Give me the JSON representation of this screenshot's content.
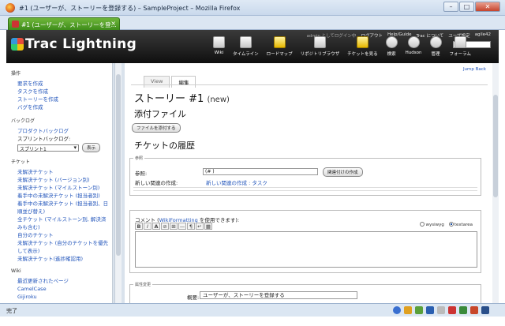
{
  "window": {
    "title": "#1 (ユーザーが、ストーリーを登録する) – SampleProject – Mozilla Firefox",
    "minimize": "–",
    "maximize": "□",
    "close": "✕"
  },
  "tab": {
    "label": "#1 (ユーザーが、ストーリーを登...",
    "close": "×"
  },
  "header": {
    "logo": "Trac Lightning",
    "metanav": [
      "admin としてログイン中",
      "ログアウト",
      "Help/Guide",
      "Trac について",
      "ユーザ設定",
      "agile42"
    ],
    "mainnav": [
      "Wiki",
      "タイムライン",
      "ロードマップ",
      "リポジトリブラウザ",
      "チケットを見る",
      "検索",
      "Hudson",
      "管理",
      "フォーラム"
    ]
  },
  "sidebar": {
    "sections": [
      {
        "title": "操作",
        "links": [
          "要求を作成",
          "タスクを作成",
          "ストーリーを作成",
          "バグを作成"
        ]
      },
      {
        "title": "バックログ",
        "links": [
          "プロダクトバックログ"
        ],
        "text": "スプリントバックログ:",
        "select": "スプリント1",
        "button": "表示"
      },
      {
        "title": "チケット",
        "links": [
          "未解決チケット",
          "未解決チケット (バージョン別)",
          "未解決チケット (マイルストーン別)",
          "着手中の未解決チケット (担当者別)",
          "着手中の未解決チケット (担当者別、日",
          "順並び替え)",
          "全チケット (マイルストーン別, 解決済",
          "みも含む)",
          "自分のチケット",
          "未解決チケット (自分のチケットを優先",
          "して表示)",
          "未解決チケット(進捗確認用)"
        ]
      },
      {
        "title": "Wiki",
        "links": [
          "最近更新されたページ",
          "CamelCase",
          "Gijiroku"
        ]
      }
    ]
  },
  "main": {
    "jump_back": "Jump Back",
    "tabs": [
      "View",
      "編集"
    ],
    "title": "ストーリー #1",
    "status": "(new)",
    "attachments_heading": "添付ファイル",
    "attach_button": "ファイルを添付する",
    "history_heading": "チケットの履歴",
    "relations": {
      "legend": "参照",
      "ref_label": "参照:",
      "ref_value": "(#        )",
      "link_button": "関連付けの作成",
      "new_label": "新しい関連の作成:",
      "new_link": "新しい関連の作成 : タスク"
    },
    "comment": {
      "label_prefix": "コメント (",
      "label_link": "WikiFormatting",
      "label_suffix": " を使用できます):",
      "toolbar": [
        "B",
        "I",
        "A",
        "⊘",
        "⊞",
        "—",
        "¶",
        "↵",
        "▦"
      ],
      "mode_wysiwyg": "wysiwyg",
      "mode_textarea": "textarea"
    },
    "properties": {
      "legend": "属性変更",
      "summary_label": "概要:",
      "summary_value": "ユーザーが、ストーリーを登録する"
    }
  },
  "statusbar": {
    "text": "完了"
  }
}
